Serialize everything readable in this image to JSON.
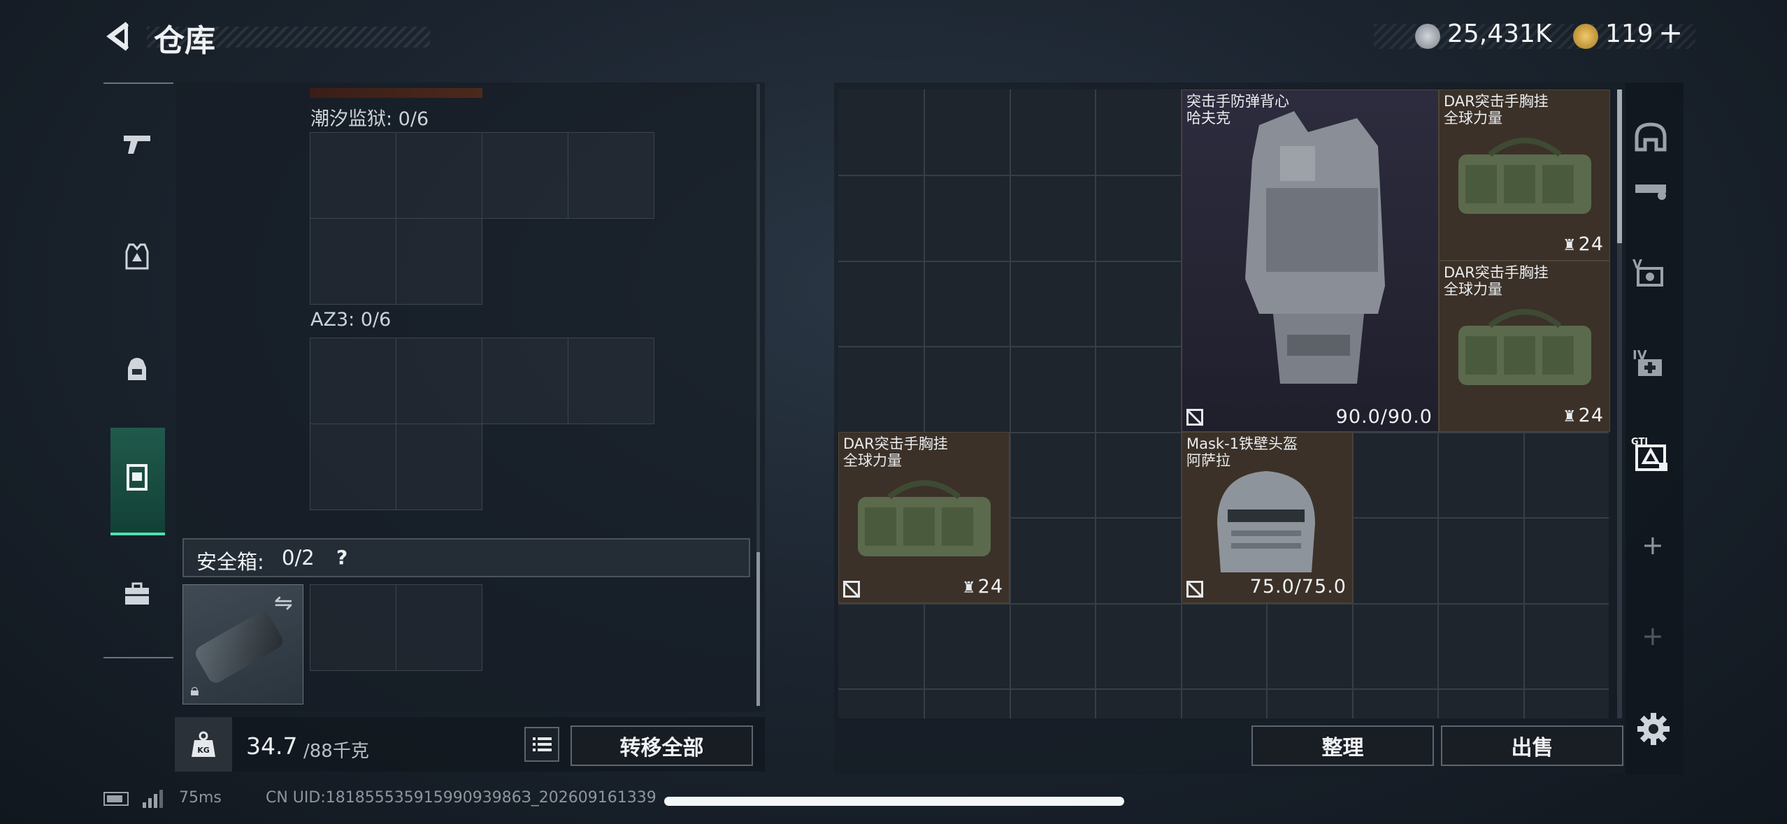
{
  "header": {
    "title": "仓库"
  },
  "currency": {
    "coins": "25,431K",
    "tokens": "119",
    "add": "+"
  },
  "left_nav": {
    "items": [
      {
        "name": "weapons",
        "icon": "pistol-icon"
      },
      {
        "name": "armor",
        "icon": "vest-icon"
      },
      {
        "name": "backpack",
        "icon": "backpack-icon"
      },
      {
        "name": "rig",
        "icon": "chest-rig-icon"
      },
      {
        "name": "toolbox",
        "icon": "toolbox-icon"
      }
    ],
    "active_index": 3
  },
  "equip_panel": {
    "sections": [
      {
        "label": "潮汐监狱: 0/6"
      },
      {
        "label": "AZ3: 0/6"
      }
    ],
    "safe_box": {
      "label": "安全箱:",
      "count": "0/2",
      "help": "?"
    }
  },
  "weight": {
    "current": "34.7",
    "max": "/88千克"
  },
  "transfer_all": "转移全部",
  "storage": {
    "items": [
      {
        "name_line1": "突击手防弹背心",
        "name_line2": "哈夫克",
        "durability": "90.0/90.0"
      },
      {
        "name_line1": "DAR突击手胸挂",
        "name_line2": "全球力量",
        "slots": "24"
      },
      {
        "name_line1": "DAR突击手胸挂",
        "name_line2": "全球力量",
        "slots": "24"
      },
      {
        "name_line1": "DAR突击手胸挂",
        "name_line2": "全球力量",
        "slots": "24"
      },
      {
        "name_line1": "Mask-1铁壁头盔",
        "name_line2": "阿萨拉",
        "durability": "75.0/75.0"
      }
    ]
  },
  "buttons": {
    "sort": "整理",
    "sell": "出售"
  },
  "right_bar": {
    "add1": "+",
    "add2": "+"
  },
  "status": {
    "ping": "75ms",
    "uid": "CN UID:18185553591599093986З_202609161339"
  },
  "colors": {
    "item_bg": "#3a3129",
    "accent_green": "#4fe0b0",
    "vest_bg": "#2a2a3a"
  }
}
